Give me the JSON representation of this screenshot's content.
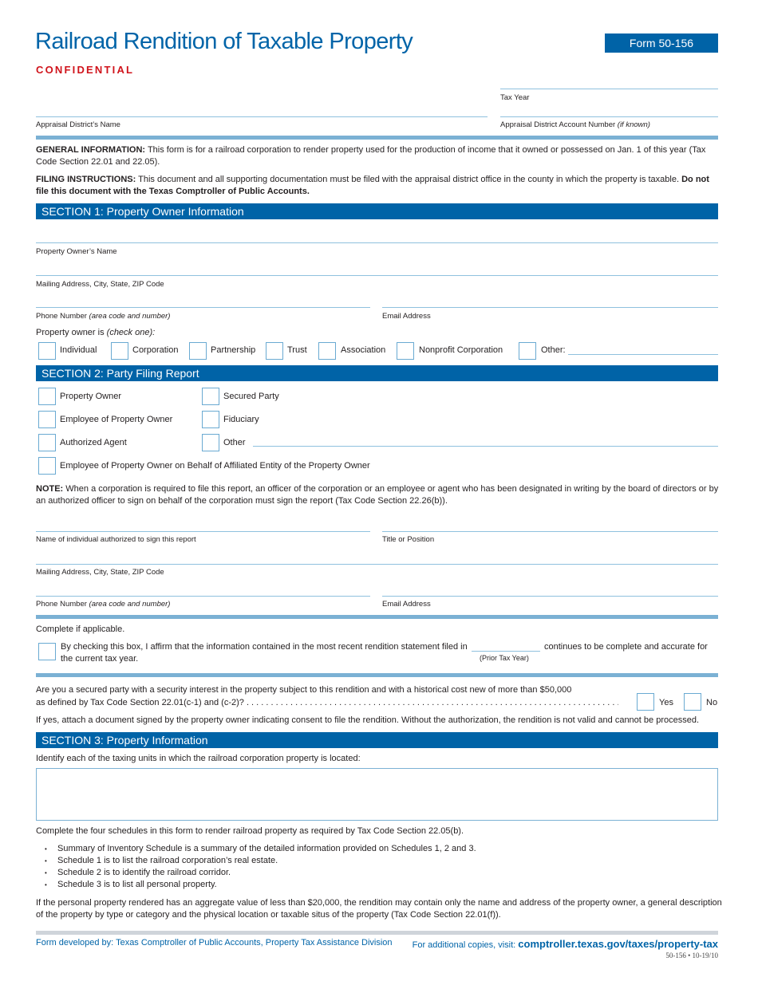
{
  "header": {
    "title": "Railroad Rendition of Taxable Property",
    "confidential": "CONFIDENTIAL",
    "form_number": "Form 50-156"
  },
  "top_fields": {
    "tax_year": "Tax Year",
    "appraisal_district_name": "Appraisal District’s Name",
    "account_number": "Appraisal District Account Number",
    "account_number_note": "(if known)"
  },
  "general_info": {
    "label": "GENERAL INFORMATION:",
    "text": " This form is for a railroad corporation to render property used for the production of income that it owned or possessed on Jan. 1 of this year (Tax Code Section 22.01 and 22.05)."
  },
  "filing_instructions": {
    "label": "FILING INSTRUCTIONS:",
    "text": " This document and all supporting documentation must be filed with the appraisal district office in the county in which the property is taxable. ",
    "bold_text": "Do not file this document with the Texas Comptroller of Public Accounts."
  },
  "section1": {
    "title": "SECTION 1: Property Owner Information",
    "owner_name": "Property Owner’s Name",
    "mailing_address": "Mailing Address, City, State, ZIP Code",
    "phone": "Phone Number",
    "phone_note": "(area code and number)",
    "email": "Email Address",
    "owner_is": "Property owner is",
    "owner_is_note": "(check one):",
    "owner_types": [
      "Individual",
      "Corporation",
      "Partnership",
      "Trust",
      "Association",
      "Nonprofit Corporation",
      "Other:"
    ]
  },
  "section2": {
    "title": "SECTION 2: Party Filing Report",
    "options_left": [
      "Property Owner",
      "Employee of Property Owner",
      "Authorized Agent"
    ],
    "options_right": [
      "Secured Party",
      "Fiduciary",
      "Other"
    ],
    "option_full": "Employee of Property Owner on Behalf of Affiliated Entity of the Property Owner",
    "note_label": "NOTE:",
    "note_text": " When a corporation is required to file this report, an officer of the corporation or an employee or agent who has been designated in writing by the board of directors or by an authorized officer to sign on behalf of the corporation must sign the report (Tax Code Section 22.26(b)).",
    "signer_name": "Name of individual authorized to sign this report",
    "title_position": "Title or Position",
    "mailing_address": "Mailing Address, City, State, ZIP Code",
    "phone": "Phone Number",
    "phone_note": "(area code and number)",
    "email": "Email Address",
    "complete_if": "Complete if applicable.",
    "affirm_text_1": "By checking this box, I affirm that the information contained in the most recent rendition statement filed in",
    "affirm_text_2": "continues to be complete and accurate for",
    "affirm_text_3": "the current tax year.",
    "prior_tax_year": "(Prior Tax Year)",
    "secured_q1": "Are you a secured party with a security interest in the property subject to this rendition and with a historical cost new of more than $50,000",
    "secured_q2": "as defined by Tax Code Section 22.01(c-1) and (c-2)? . . . . . . . . . . . . . . . . . . . . . . . . . . . . . . . . . . . . . . . . . . . . . . . . . . . . . . . . . . . . . . . . . . . . . . . . . . . . . . . . . . . . . . . . . . . . . . . . . . . . . . . . . .",
    "yes": "Yes",
    "no": "No",
    "if_yes": "If yes, attach a document signed by the property owner indicating consent to file the rendition. Without the authorization, the rendition is not valid and cannot be processed."
  },
  "section3": {
    "title": "SECTION 3: Property Information",
    "identify": "Identify each of the taxing units in which the railroad corporation property is located:",
    "complete_four": "Complete the four schedules in this form to render railroad property as required by Tax Code Section 22.05(b).",
    "bullets": [
      "Summary of Inventory Schedule is a summary of the detailed information provided on Schedules 1, 2 and 3.",
      "Schedule 1 is to list the railroad corporation’s real estate.",
      "Schedule 2 is to identify the railroad corridor.",
      "Schedule 3 is to list all personal property."
    ],
    "personal_property": "If the personal property rendered has an aggregate value of less than $20,000, the rendition may contain only the name and address of the property owner, a general description of the property by type or category and the physical location or taxable situs of the property (Tax Code Section 22.01(f))."
  },
  "footer": {
    "developed_by": "Form developed by: Texas Comptroller of Public Accounts, Property Tax Assistance Division",
    "copies_label": "For additional copies, visit: ",
    "copies_url": "comptroller.texas.gov/taxes/property-tax",
    "code": "50-156 • 10-19/10"
  }
}
